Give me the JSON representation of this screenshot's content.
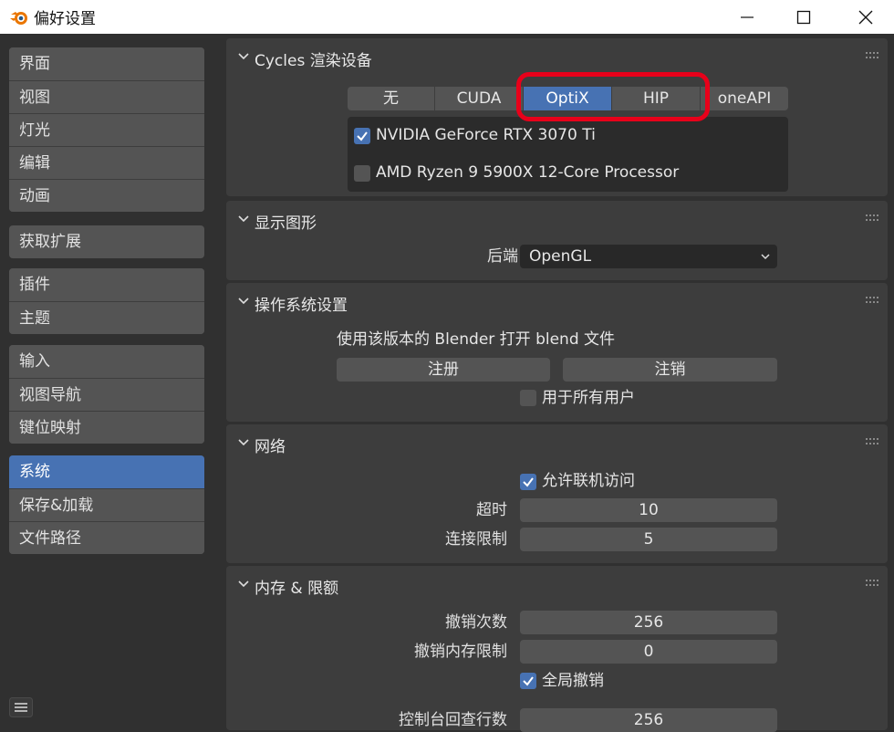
{
  "window": {
    "title": "偏好设置"
  },
  "sidebar": {
    "groups": [
      [
        "界面",
        "视图",
        "灯光",
        "编辑",
        "动画"
      ],
      [
        "获取扩展"
      ],
      [
        "插件",
        "主题"
      ],
      [
        "输入",
        "视图导航",
        "键位映射"
      ],
      [
        "系统",
        "保存&加载",
        "文件路径"
      ]
    ],
    "active": "系统"
  },
  "cycles": {
    "title": "Cycles 渲染设备",
    "tabs": [
      "无",
      "CUDA",
      "OptiX",
      "HIP",
      "oneAPI"
    ],
    "active_tab": "OptiX",
    "devices": [
      {
        "name": "NVIDIA GeForce RTX 3070 Ti",
        "checked": true
      },
      {
        "name": "AMD Ryzen 9 5900X 12-Core Processor",
        "checked": false
      }
    ]
  },
  "display": {
    "title": "显示图形",
    "backend_label": "后端",
    "backend_value": "OpenGL"
  },
  "os": {
    "title": "操作系统设置",
    "open_with_text": "使用该版本的 Blender 打开 blend 文件",
    "register_label": "注册",
    "unregister_label": "注销",
    "all_users_label": "用于所有用户",
    "all_users_checked": false
  },
  "network": {
    "title": "网络",
    "allow_online_label": "允许联机访问",
    "allow_online_checked": true,
    "timeout_label": "超时",
    "timeout_value": "10",
    "conn_limit_label": "连接限制",
    "conn_limit_value": "5"
  },
  "memory": {
    "title": "内存 & 限额",
    "undo_steps_label": "撤销次数",
    "undo_steps_value": "256",
    "undo_mem_label": "撤销内存限制",
    "undo_mem_value": "0",
    "global_undo_label": "全局撤销",
    "global_undo_checked": true,
    "console_scrollback_label": "控制台回查行数",
    "console_scrollback_value": "256"
  },
  "colors": {
    "accent": "#4772b3",
    "highlight": "#e8001a"
  },
  "icons": [
    "blender-logo-icon",
    "minimize-icon",
    "maximize-icon",
    "close-icon",
    "chevron-down-icon",
    "grip-icon",
    "checkmark-icon",
    "hamburger-menu-icon"
  ]
}
